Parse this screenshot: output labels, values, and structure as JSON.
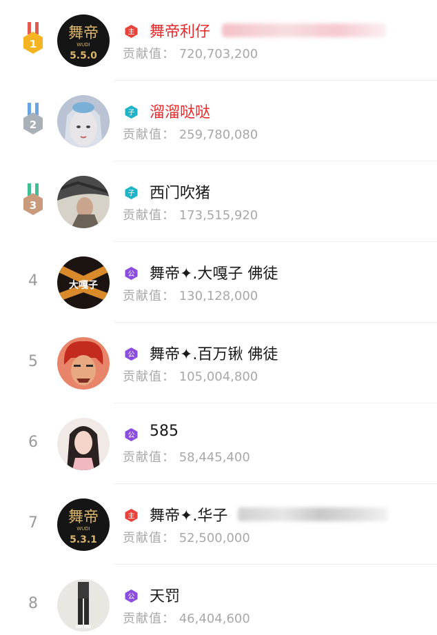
{
  "score_label": "贡献值：",
  "entries": [
    {
      "rank": "1",
      "name": "舞帝利仔",
      "score": "720,703,200",
      "role": "主",
      "medal": "gold",
      "name_color": "red",
      "avatar_text": "舞帝",
      "avatar_sub": "WUDI",
      "avatar_num": "5.5.0"
    },
    {
      "rank": "2",
      "name": "溜溜哒哒",
      "score": "259,780,080",
      "role": "子",
      "medal": "silver",
      "name_color": "red"
    },
    {
      "rank": "3",
      "name": "西门吹猪",
      "score": "173,515,920",
      "role": "子",
      "medal": "bronze",
      "name_color": "normal"
    },
    {
      "rank": "4",
      "name": "舞帝✦.大嘎子  佛徒",
      "score": "130,128,000",
      "role": "公",
      "name_color": "normal",
      "avatar_text": "大嘎子"
    },
    {
      "rank": "5",
      "name": "舞帝✦.百万锹  佛徒",
      "score": "105,004,800",
      "role": "公",
      "name_color": "normal"
    },
    {
      "rank": "6",
      "name": "585",
      "score": "58,445,400",
      "role": "公",
      "name_color": "normal"
    },
    {
      "rank": "7",
      "name": "舞帝✦.华子",
      "score": "52,500,000",
      "role": "主",
      "name_color": "normal",
      "avatar_text": "舞帝",
      "avatar_sub": "WUDI",
      "avatar_num": "5.3.1"
    },
    {
      "rank": "8",
      "name": "天罚",
      "score": "46,404,600",
      "role": "公",
      "name_color": "normal"
    }
  ],
  "colors": {
    "name_red": "#e82a2a",
    "role_main": "#e8433a",
    "role_child": "#1fb3c8",
    "role_public": "#8a4de0",
    "gold": "#f5b523",
    "silver": "#a9b0b8",
    "bronze": "#c99a7c"
  }
}
